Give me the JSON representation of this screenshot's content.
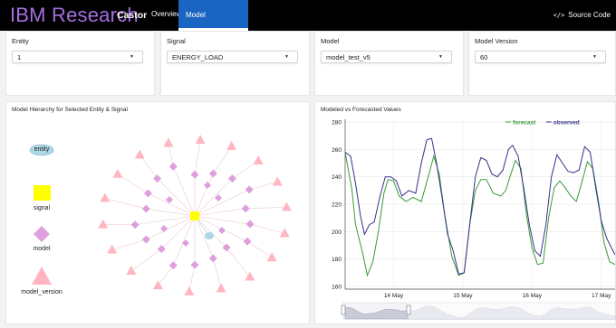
{
  "header": {
    "brand": "IBM Research",
    "app_name": "Castor",
    "nav": [
      {
        "label": "Overview"
      },
      {
        "label": "Model Management"
      }
    ],
    "source_code_label": "Source Code"
  },
  "filters": [
    {
      "label": "Entity",
      "value": "1"
    },
    {
      "label": "Signal",
      "value": "ENERGY_LOAD"
    },
    {
      "label": "Model",
      "value": "model_test_v5"
    },
    {
      "label": "Model Version",
      "value": "60"
    }
  ],
  "hierarchy_panel": {
    "title": "Model Hierarchy for Selected Entity & Signal",
    "legend": [
      {
        "label": "entity",
        "color": "#add8e6"
      },
      {
        "label": "signal",
        "color": "#ffff00"
      },
      {
        "label": "model",
        "color": "#dda0dd"
      },
      {
        "label": "model_version",
        "color": "#ffb6c1"
      }
    ]
  },
  "colors": {
    "forecast": "#3a9a3a",
    "observed": "#33338a",
    "accent": "#1b65c2"
  },
  "chart_data": {
    "type": "line",
    "title": "Modeled vs Forecasted Values",
    "x_ticks": [
      "14 May",
      "15 May",
      "16 May",
      "17 May"
    ],
    "ylim": [
      158,
      282
    ],
    "y_ticks": [
      160,
      180,
      200,
      220,
      240,
      260,
      280
    ],
    "grid": true,
    "legend_position": "top-right",
    "series": [
      {
        "name": "forecast",
        "color": "#3a9a3a",
        "points": [
          [
            -0.7,
            258
          ],
          [
            -0.6,
            230
          ],
          [
            -0.55,
            205
          ],
          [
            -0.45,
            185
          ],
          [
            -0.38,
            168
          ],
          [
            -0.3,
            178
          ],
          [
            -0.22,
            200
          ],
          [
            -0.14,
            228
          ],
          [
            -0.08,
            238
          ],
          [
            0.0,
            237
          ],
          [
            0.08,
            226
          ],
          [
            0.18,
            222
          ],
          [
            0.28,
            225
          ],
          [
            0.4,
            222
          ],
          [
            0.5,
            240
          ],
          [
            0.58,
            255
          ],
          [
            0.66,
            242
          ],
          [
            0.74,
            212
          ],
          [
            0.84,
            182
          ],
          [
            0.94,
            168
          ],
          [
            1.02,
            170
          ],
          [
            1.1,
            205
          ],
          [
            1.18,
            230
          ],
          [
            1.26,
            238
          ],
          [
            1.34,
            238
          ],
          [
            1.44,
            228
          ],
          [
            1.55,
            226
          ],
          [
            1.62,
            230
          ],
          [
            1.68,
            240
          ],
          [
            1.76,
            252
          ],
          [
            1.84,
            246
          ],
          [
            1.92,
            212
          ],
          [
            2.0,
            188
          ],
          [
            2.08,
            176
          ],
          [
            2.16,
            177
          ],
          [
            2.24,
            210
          ],
          [
            2.32,
            232
          ],
          [
            2.4,
            237
          ],
          [
            2.48,
            232
          ],
          [
            2.56,
            226
          ],
          [
            2.64,
            222
          ],
          [
            2.72,
            236
          ],
          [
            2.8,
            251
          ],
          [
            2.88,
            246
          ],
          [
            2.96,
            222
          ],
          [
            3.04,
            192
          ],
          [
            3.12,
            178
          ],
          [
            3.2,
            176
          ]
        ]
      },
      {
        "name": "observed",
        "color": "#33338a",
        "points": [
          [
            -0.7,
            258
          ],
          [
            -0.62,
            255
          ],
          [
            -0.55,
            235
          ],
          [
            -0.48,
            212
          ],
          [
            -0.42,
            198
          ],
          [
            -0.35,
            205
          ],
          [
            -0.28,
            207
          ],
          [
            -0.2,
            225
          ],
          [
            -0.12,
            240
          ],
          [
            -0.04,
            240
          ],
          [
            0.04,
            237
          ],
          [
            0.12,
            226
          ],
          [
            0.22,
            230
          ],
          [
            0.32,
            228
          ],
          [
            0.4,
            250
          ],
          [
            0.48,
            267
          ],
          [
            0.55,
            268
          ],
          [
            0.62,
            250
          ],
          [
            0.7,
            225
          ],
          [
            0.78,
            198
          ],
          [
            0.86,
            186
          ],
          [
            0.94,
            169
          ],
          [
            1.02,
            170
          ],
          [
            1.1,
            205
          ],
          [
            1.18,
            240
          ],
          [
            1.26,
            254
          ],
          [
            1.34,
            252
          ],
          [
            1.42,
            242
          ],
          [
            1.5,
            240
          ],
          [
            1.58,
            245
          ],
          [
            1.66,
            260
          ],
          [
            1.72,
            263
          ],
          [
            1.8,
            255
          ],
          [
            1.88,
            232
          ],
          [
            1.96,
            205
          ],
          [
            2.04,
            186
          ],
          [
            2.12,
            182
          ],
          [
            2.2,
            205
          ],
          [
            2.28,
            240
          ],
          [
            2.36,
            256
          ],
          [
            2.44,
            250
          ],
          [
            2.52,
            244
          ],
          [
            2.6,
            243
          ],
          [
            2.68,
            245
          ],
          [
            2.76,
            262
          ],
          [
            2.84,
            258
          ],
          [
            2.92,
            232
          ],
          [
            3.0,
            208
          ],
          [
            3.08,
            195
          ],
          [
            3.16,
            187
          ],
          [
            3.2,
            183
          ]
        ]
      }
    ]
  }
}
